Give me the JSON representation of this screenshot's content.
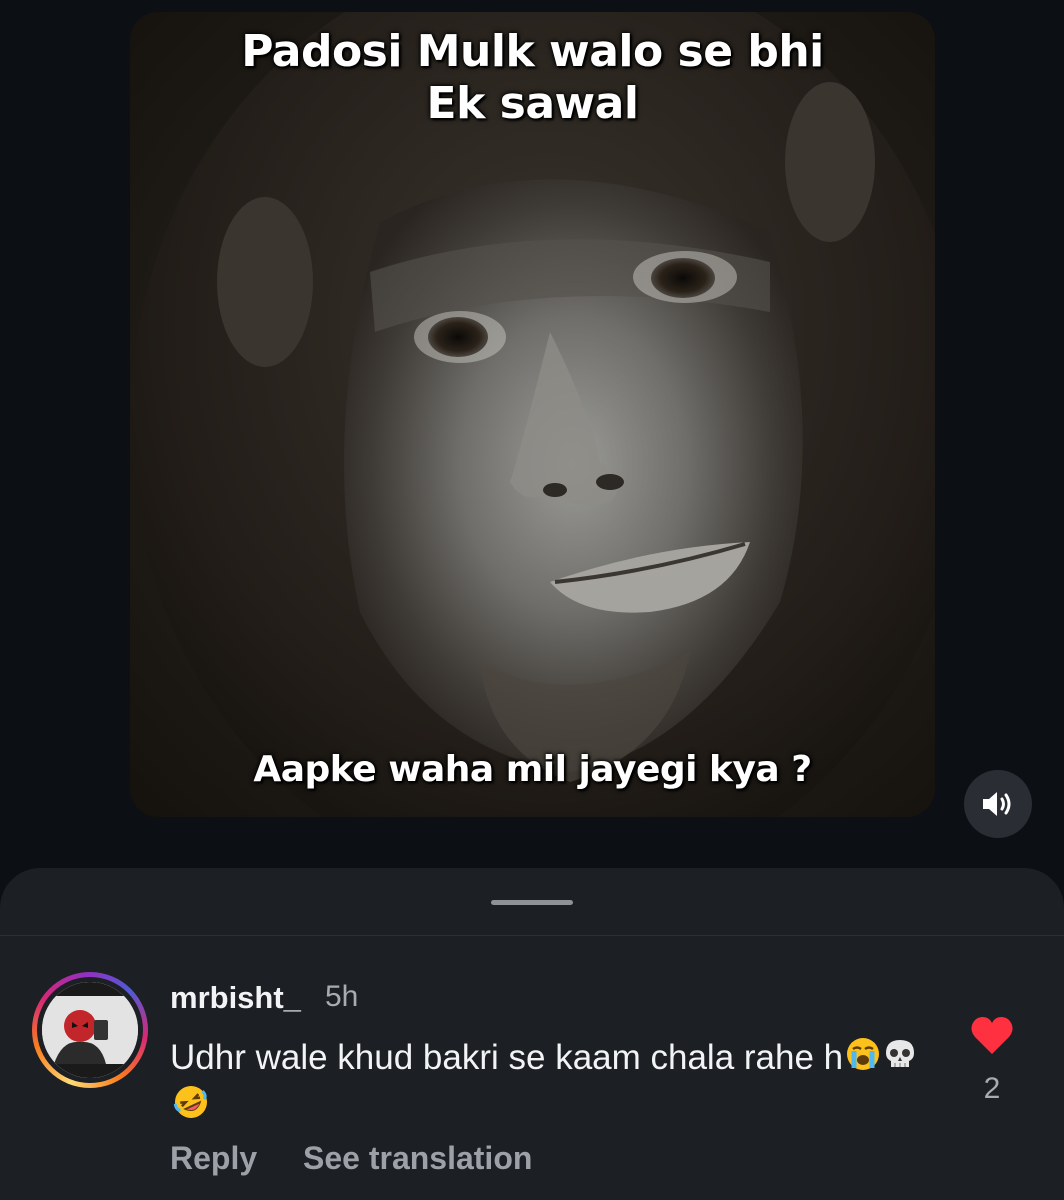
{
  "post": {
    "caption_top_line1": "Padosi Mulk walo se bhi",
    "caption_top_line2": "Ek sawal",
    "caption_bottom": "Aapke waha mil jayegi kya ?"
  },
  "controls": {
    "sound_icon": "speaker-volume-icon"
  },
  "comment": {
    "username": "mrbisht_",
    "time": "5h",
    "text": "Udhr wale khud bakri se kaam chala rahe h",
    "emojis": [
      "loudly-crying-face",
      "skull",
      "rolling-on-floor-laughing"
    ],
    "like_count": "2",
    "like_icon": "heart-filled-icon",
    "like_color": "#ff3040",
    "reply_label": "Reply",
    "see_translation_label": "See translation"
  },
  "colors": {
    "background": "#0c0f14",
    "sheet": "#1c1f24",
    "secondary_text": "#a8abb0"
  }
}
